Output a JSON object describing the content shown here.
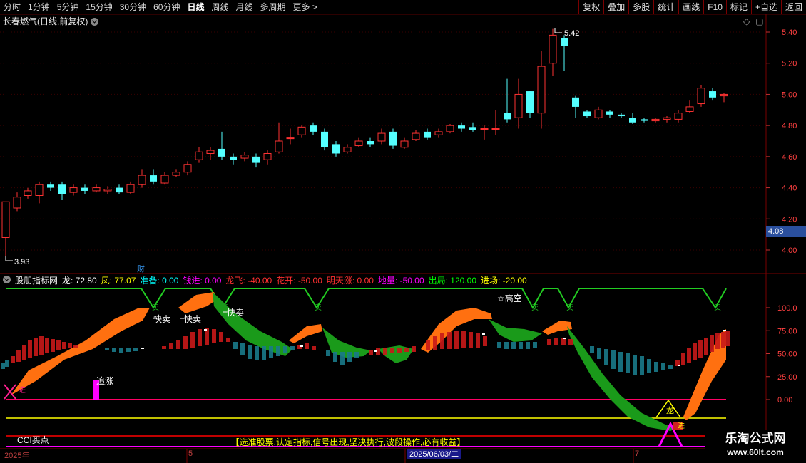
{
  "toolbar": {
    "periods": [
      "分时",
      "1分钟",
      "5分钟",
      "15分钟",
      "30分钟",
      "60分钟",
      "日线",
      "周线",
      "月线",
      "多周期",
      "更多 >"
    ],
    "active_period": "日线",
    "right_buttons": [
      "复权",
      "叠加",
      "多股",
      "统计",
      "画线",
      "F10",
      "标记",
      "+自选",
      "返回"
    ]
  },
  "price_panel": {
    "title": "长春燃气(日线,前复权)",
    "top_right_icons": [
      "◇",
      "▢"
    ],
    "axis_ticks": [
      "5.40",
      "5.20",
      "5.00",
      "4.80",
      "4.60",
      "4.40",
      "4.20",
      "4.00"
    ],
    "current_price": "4.08",
    "high_label": "5.42",
    "low_label": "3.93",
    "marker_cai": "财"
  },
  "indicator_panel": {
    "name": "股朋指标网",
    "values": [
      {
        "label": "龙:",
        "value": "72.80",
        "color": "#ffffff"
      },
      {
        "label": "凤:",
        "value": "77.07",
        "color": "#ffff00"
      },
      {
        "label": "准备:",
        "value": "0.00",
        "color": "#00ffff"
      },
      {
        "label": "钱进:",
        "value": "0.00",
        "color": "#ff00ff"
      },
      {
        "label": "龙飞:",
        "value": "-40.00",
        "color": "#ff3030"
      },
      {
        "label": "花开:",
        "value": "-50.00",
        "color": "#ff3030"
      },
      {
        "label": "明天涨:",
        "value": "0.00",
        "color": "#ff3030"
      },
      {
        "label": "地量:",
        "value": "-50.00",
        "color": "#ff00ff"
      },
      {
        "label": "出局:",
        "value": "120.00",
        "color": "#00ff00"
      },
      {
        "label": "进场:",
        "value": "-20.00",
        "color": "#ffff00"
      }
    ],
    "axis_ticks": [
      "100.0",
      "75.00",
      "50.00",
      "25.00",
      "0.00"
    ],
    "annotations": {
      "kuaimai": "快卖",
      "gaokong": "☆高空",
      "zhuizhang": "追涨",
      "cci": "CCI买点",
      "long": "龙",
      "jin": "进",
      "banner": "【选准股票,认定指标,信号出现,坚决执行,波段操作,必有收益】",
      "marker_small": "卖"
    }
  },
  "date_bar": {
    "labels": [
      "2025年",
      "5",
      "6",
      "7"
    ],
    "highlight": "2025/06/03/二"
  },
  "watermark": {
    "title": "乐淘公式网",
    "url": "www.60lt.com"
  }
}
